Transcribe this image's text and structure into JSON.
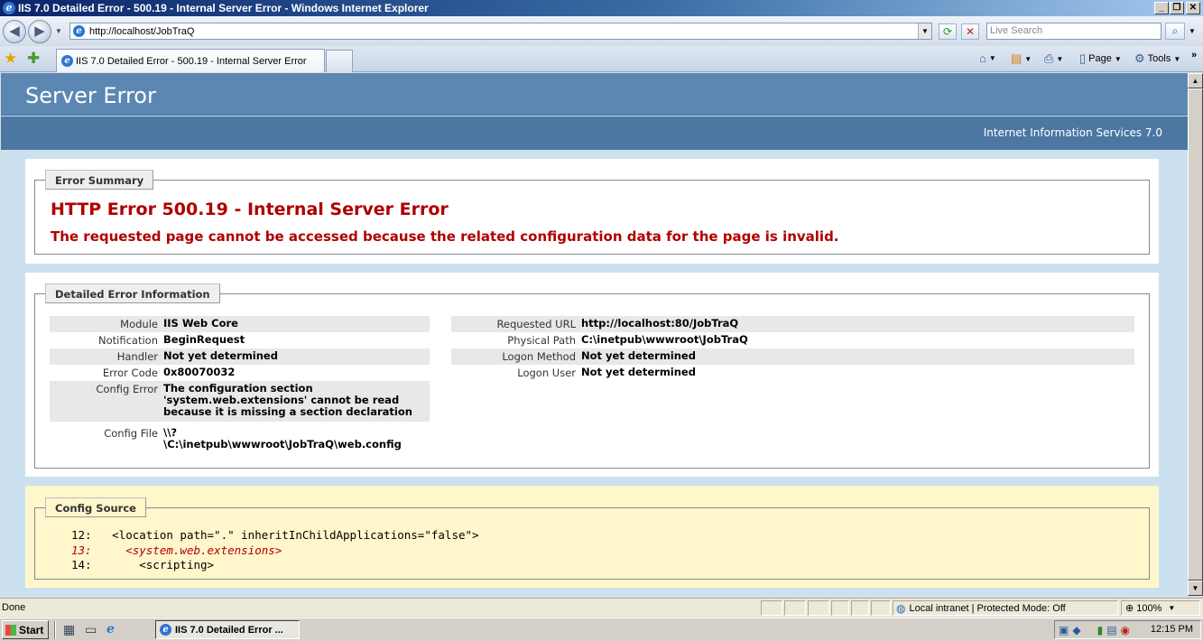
{
  "window": {
    "title": "IIS 7.0 Detailed Error - 500.19 - Internal Server Error - Windows Internet Explorer"
  },
  "address": {
    "url": "http://localhost/JobTraQ"
  },
  "search": {
    "placeholder": "Live Search"
  },
  "tab": {
    "label": "IIS 7.0 Detailed Error - 500.19 - Internal Server Error"
  },
  "commands": {
    "page": "Page",
    "tools": "Tools"
  },
  "page": {
    "header_title": "Server Error",
    "subheader": "Internet Information Services 7.0",
    "summary": {
      "legend": "Error Summary",
      "title": "HTTP Error 500.19 - Internal Server Error",
      "subtitle": "The requested page cannot be accessed because the related configuration data for the page is invalid."
    },
    "details": {
      "legend": "Detailed Error Information",
      "left": [
        {
          "label": "Module",
          "value": "IIS Web Core"
        },
        {
          "label": "Notification",
          "value": "BeginRequest"
        },
        {
          "label": "Handler",
          "value": "Not yet determined"
        },
        {
          "label": "Error Code",
          "value": "0x80070032"
        },
        {
          "label": "Config Error",
          "value_lines": [
            "The configuration section",
            "'system.web.extensions' cannot be read",
            "because it is missing a section declaration"
          ]
        },
        {
          "label": "Config File",
          "value_lines": [
            "\\\\?",
            "\\C:\\inetpub\\wwwroot\\JobTraQ\\web.config"
          ]
        }
      ],
      "right": [
        {
          "label": "Requested URL",
          "value": "http://localhost:80/JobTraQ"
        },
        {
          "label": "Physical Path",
          "value": "C:\\inetpub\\wwwroot\\JobTraQ"
        },
        {
          "label": "Logon Method",
          "value": "Not yet determined"
        },
        {
          "label": "Logon User",
          "value": "Not yet determined"
        }
      ]
    },
    "config_source": {
      "legend": "Config Source",
      "lines": [
        {
          "num": "12:",
          "code": "<location path=\".\" inheritInChildApplications=\"false\">"
        },
        {
          "num": "13:",
          "code": "  <system.web.extensions>"
        },
        {
          "num": "14:",
          "code": "    <scripting>"
        }
      ]
    }
  },
  "status": {
    "text": "Done",
    "zone": "Local intranet | Protected Mode: Off",
    "zoom": "100%"
  },
  "taskbar": {
    "start": "Start",
    "task": "IIS 7.0 Detailed Error ...",
    "clock": "12:15 PM"
  },
  "colors": {
    "error_red": "#b00000",
    "header_blue": "#5c87b2",
    "config_bg": "#fff6cc"
  },
  "icons": [
    "ie-icon",
    "back-icon",
    "forward-icon",
    "refresh-icon",
    "stop-icon",
    "search-icon",
    "favorites-star-icon",
    "add-favorites-icon",
    "home-icon",
    "feeds-icon",
    "print-icon",
    "tools-gear-icon",
    "globe-icon",
    "zoom-icon"
  ]
}
